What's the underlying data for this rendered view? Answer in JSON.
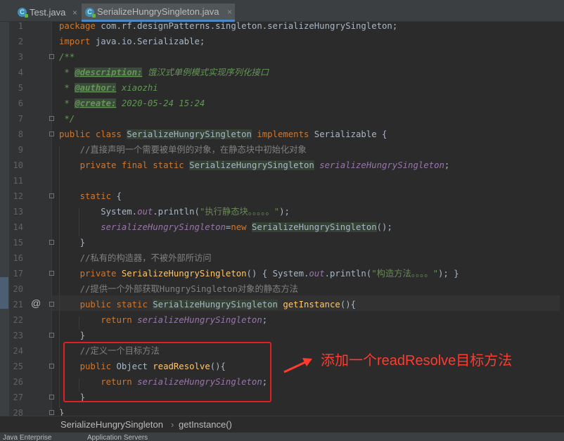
{
  "tabs": [
    {
      "label": "Test.java",
      "active": false
    },
    {
      "label": "SerializeHungrySingleton.java",
      "active": true
    }
  ],
  "tab_icon": "java-class-icon",
  "close_glyph": "×",
  "lines": [
    {
      "n": "1",
      "html": "<span class=\"kw\">package</span> com.rf.designPatterns.singleton.serializeHungrySingleton;"
    },
    {
      "n": "2",
      "html": "<span class=\"kw\">import</span> java.io.Serializable;"
    },
    {
      "n": "3",
      "html": "<span class=\"doc\">/**</span>"
    },
    {
      "n": "4",
      "html": "<span class=\"doc\"> * </span><span class=\"tag\">@description:</span><span class=\"tagv\"> 饿汉式单例模式实现序列化接口</span>"
    },
    {
      "n": "5",
      "html": "<span class=\"doc\"> * </span><span class=\"tag\">@author:</span><span class=\"tagv\"> xiaozhi</span>"
    },
    {
      "n": "6",
      "html": "<span class=\"doc\"> * </span><span class=\"tag\">@create:</span><span class=\"tagv\"> 2020-05-24 15:24</span>"
    },
    {
      "n": "7",
      "html": "<span class=\"doc\"> */</span>"
    },
    {
      "n": "8",
      "html": "<span class=\"kw\">public class</span> <span class=\"sel\">SerializeHungrySingleton</span> <span class=\"kw\">implements</span> Serializable {"
    },
    {
      "n": "9",
      "html": "    <span class=\"cm\">//直接声明一个需要被单例的对象，在静态块中初始化对象</span>"
    },
    {
      "n": "10",
      "html": "    <span class=\"kw\">private final static</span> <span class=\"sel\">SerializeHungrySingleton</span> <span class=\"fld\">serializeHungrySingleton</span>;"
    },
    {
      "n": "11",
      "html": ""
    },
    {
      "n": "12",
      "html": "    <span class=\"kw\">static</span> {"
    },
    {
      "n": "13",
      "html": "        System.<span class=\"fld\">out</span>.println(<span class=\"str\">\"执行静态块。。。。。\"</span>);"
    },
    {
      "n": "14",
      "html": "        <span class=\"fld\">serializeHungrySingleton</span>=<span class=\"kw\">new</span> <span class=\"sel\">SerializeHungrySingleton</span>();"
    },
    {
      "n": "15",
      "html": "    }"
    },
    {
      "n": "16",
      "html": "    <span class=\"cm\">//私有的构造器，不被外部所访问</span>"
    },
    {
      "n": "17",
      "html": "    <span class=\"kw\">private</span> <span class=\"mth\">SerializeHungrySingleton</span>() { System.<span class=\"fld\">out</span>.println(<span class=\"str\">\"构造方法。。。。\"</span>); }"
    },
    {
      "n": "20",
      "html": "    <span class=\"cm\">//提供一个外部获取HungrySingleton对象的静态方法</span>"
    },
    {
      "n": "21",
      "html": "    <span class=\"kw\">public static</span> <span class=\"sel\">SerializeHungrySingleton</span> <span class=\"mth\">getInstance</span>(){"
    },
    {
      "n": "22",
      "html": "        <span class=\"kw\">return</span> <span class=\"fld\">serializeHungrySingleton</span>;"
    },
    {
      "n": "23",
      "html": "    }"
    },
    {
      "n": "24",
      "html": "    <span class=\"cm\">//定义一个目标方法</span>"
    },
    {
      "n": "25",
      "html": "    <span class=\"kw\">public</span> Object <span class=\"mth\">readResolve</span>(){"
    },
    {
      "n": "26",
      "html": "        <span class=\"kw\">return</span> <span class=\"fld\">serializeHungrySingleton</span>;"
    },
    {
      "n": "27",
      "html": "    }"
    },
    {
      "n": "28",
      "html": "}"
    }
  ],
  "override_marker": "@",
  "annotation": "添加一个readResolve目标方法",
  "breadcrumb": {
    "class": "SerializeHungrySingleton",
    "separator": "›",
    "method": "getInstance()"
  },
  "bottom_bar": {
    "left": "Java Enterprise",
    "right": "Application Servers"
  },
  "colors": {
    "keyword": "#cc7832",
    "comment": "#808080",
    "field": "#9876aa",
    "string": "#6a8759",
    "method": "#ffc66d",
    "annotation": "#ff3b30"
  }
}
